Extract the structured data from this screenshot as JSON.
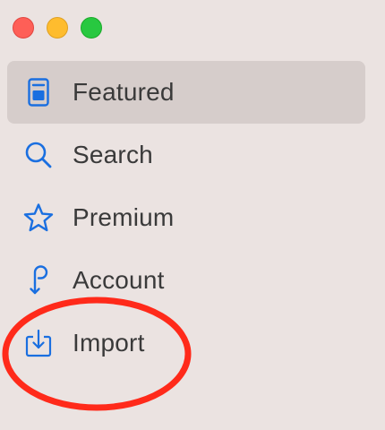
{
  "window": {
    "controls": [
      "close",
      "minimize",
      "zoom"
    ]
  },
  "sidebar": {
    "items": [
      {
        "label": "Featured",
        "icon": "featured-icon",
        "selected": true
      },
      {
        "label": "Search",
        "icon": "search-icon",
        "selected": false
      },
      {
        "label": "Premium",
        "icon": "star-icon",
        "selected": false
      },
      {
        "label": "Account",
        "icon": "account-icon",
        "selected": false
      },
      {
        "label": "Import",
        "icon": "import-icon",
        "selected": false
      }
    ]
  },
  "colors": {
    "background": "#ebe3e1",
    "selection": "#d6cdcb",
    "accent": "#1a6fe0",
    "annotation": "#ff2a1a"
  }
}
